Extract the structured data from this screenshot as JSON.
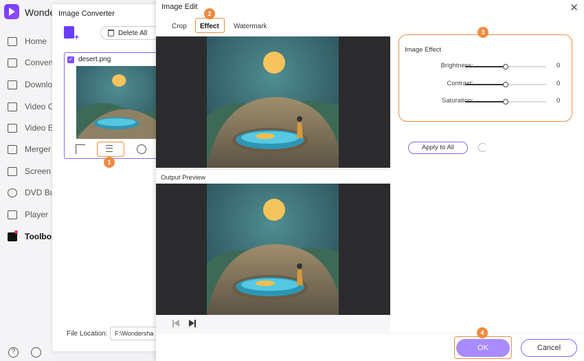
{
  "app": {
    "name": "Wonder"
  },
  "sidebar": {
    "items": [
      {
        "label": "Home"
      },
      {
        "label": "Converte"
      },
      {
        "label": "Downlo"
      },
      {
        "label": "Video Co"
      },
      {
        "label": "Video Ec"
      },
      {
        "label": "Merger"
      },
      {
        "label": "Screen R"
      },
      {
        "label": "DVD Bur"
      },
      {
        "label": "Player"
      },
      {
        "label": "Toolbox"
      }
    ],
    "active_index": 9
  },
  "converter": {
    "title": "Image Converter",
    "delete_all_label": "Delete All",
    "file": {
      "name": "desert.png",
      "checked": true
    },
    "file_location_label": "File Location:",
    "file_location_value": "F:\\Wondersha"
  },
  "dialog": {
    "title": "Image Edit",
    "close_glyph": "✕",
    "tabs": [
      {
        "label": "Crop"
      },
      {
        "label": "Effect"
      },
      {
        "label": "Watermark"
      }
    ],
    "active_tab": "Effect",
    "output_preview_label": "Output Preview",
    "effect_panel": {
      "title": "Image Effect",
      "sliders": [
        {
          "label": "Brightness:",
          "value": "0",
          "level": 0.5
        },
        {
          "label": "Contrast:",
          "value": "0",
          "level": 0.5
        },
        {
          "label": "Saturation:",
          "value": "0",
          "level": 0.5
        }
      ]
    },
    "apply_all_label": "Apply to All",
    "ok_label": "OK",
    "cancel_label": "Cancel"
  },
  "badges": [
    "1",
    "2",
    "3",
    "4"
  ],
  "colors": {
    "accent": "#7b52ff",
    "highlight": "#f08a3c",
    "ok_button": "#a88bff"
  }
}
